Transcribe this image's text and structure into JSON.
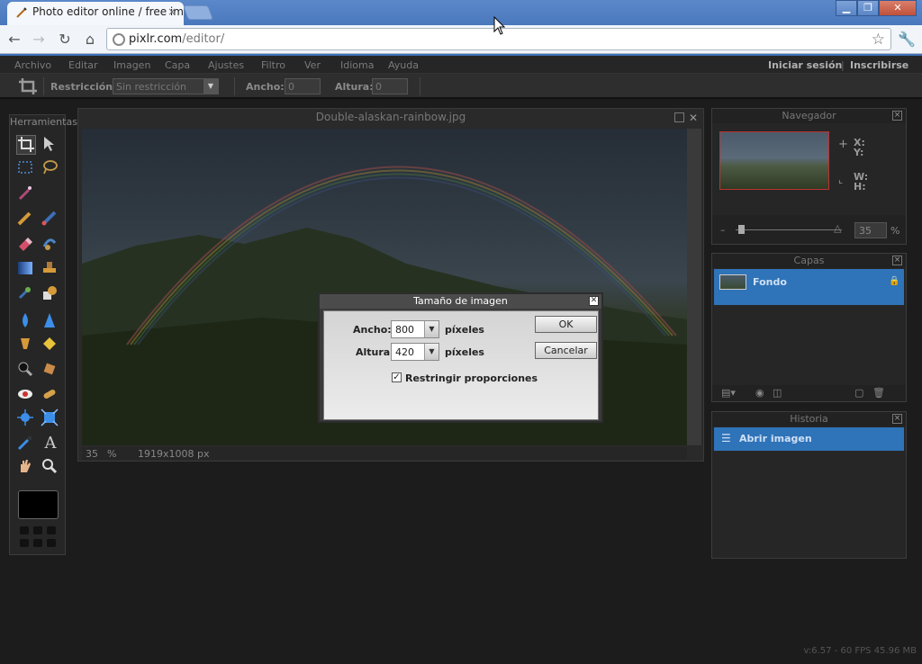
{
  "browser": {
    "tab_title": "Photo editor online / free imag",
    "tab_close": "×",
    "url_host": "pixlr.com",
    "url_path": "/editor/",
    "win_minimize": "▁",
    "win_restore": "❐",
    "win_close": "✕"
  },
  "menubar": {
    "items": [
      "Archivo",
      "Editar",
      "Imagen",
      "Capa",
      "Ajustes",
      "Filtro",
      "Ver",
      "Idioma",
      "Ayuda"
    ],
    "login": "Iniciar sesión",
    "separator": "|",
    "signup": "Inscribirse"
  },
  "options": {
    "restriction_label": "Restricción:",
    "restriction_value": "Sin restricción",
    "width_label": "Ancho:",
    "width_value": "0",
    "height_label": "Altura:",
    "height_value": "0"
  },
  "tools": {
    "title": "Herramientas"
  },
  "image_window": {
    "title": "Double-alaskan-rainbow.jpg",
    "zoom": "35",
    "zoom_unit": "%",
    "size": "1919x1008 px"
  },
  "navigator": {
    "title": "Navegador",
    "x_label": "X:",
    "y_label": "Y:",
    "w_label": "W:",
    "h_label": "H:",
    "zoom_value": "35",
    "zoom_unit": "%"
  },
  "layers": {
    "title": "Capas",
    "items": [
      {
        "name": "Fondo"
      }
    ]
  },
  "history": {
    "title": "Historia",
    "items": [
      {
        "name": "Abrir imagen"
      }
    ]
  },
  "dialog": {
    "title": "Tamaño de imagen",
    "width_label": "Ancho:",
    "width_value": "800",
    "height_label": "Altura:",
    "height_value": "420",
    "unit": "píxeles",
    "ok": "OK",
    "cancel": "Cancelar",
    "constrain_label": "Restringir proporciones",
    "constrain_checked": true
  },
  "status": {
    "footer": "v:6.57 - 60 FPS 45.96 MB"
  },
  "colors": {
    "selection_blue": "#2f73b8",
    "panel_bg": "#262626",
    "chrome_blue": "#4a78bd"
  }
}
